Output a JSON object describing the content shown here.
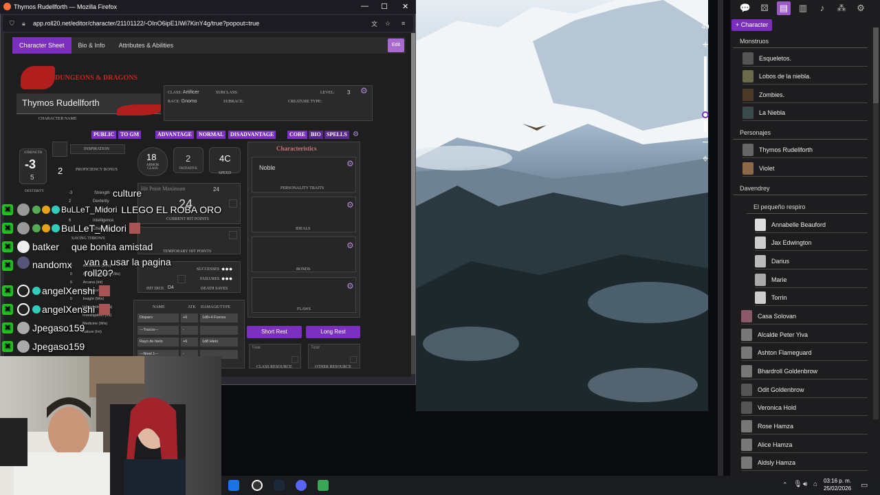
{
  "window": {
    "title": "Thymos Rudellforth — Mozilla Firefox",
    "url": "app.roll20.net/editor/character/21101122/-OInO6ipE1IWi7KinY4g/true?popout=true",
    "icons": [
      "firefox-icon",
      "minimize-icon",
      "maximize-icon",
      "close-icon",
      "lock-icon",
      "translate-icon",
      "star-icon",
      "menu-icon"
    ]
  },
  "sheet": {
    "tabs": [
      "Character Sheet",
      "Bio & Info",
      "Attributes & Abilities"
    ],
    "edit": "Edit",
    "logo": "DUNGEONS & DRAGONS",
    "character_name": "Thymos Rudellforth",
    "character_name_label": "CHARACTER NAME",
    "class_label": "CLASS:",
    "class_value": "Artificer",
    "subclass_label": "SUBCLASS:",
    "level_label": "LEVEL:",
    "level_value": "3",
    "race_label": "RACE:",
    "race_value": "Gnomo",
    "subrace_label": "SUBRACE:",
    "creature_type_label": "CREATURE TYPE:",
    "pills": [
      "PUBLIC",
      "TO GM",
      "ADVANTAGE",
      "NORMAL",
      "DISADVANTAGE",
      "CORE",
      "BIO",
      "SPELLS"
    ],
    "strength_label": "STRENGTH",
    "strength_mod": "-3",
    "strength_score": "5",
    "dexterity_label": "DEXTERITY",
    "inspiration_label": "INSPIRATION",
    "proficiency_value": "2",
    "proficiency_label": "PROFICIENCY BONUS",
    "armor_class": "18",
    "armor_class_label": "ARMOR CLASS",
    "initiative": "2",
    "initiative_label": "INITIATIVE",
    "speed": "4C",
    "speed_label": "SPEED",
    "hp_max_label": "Hit Point Maximum",
    "hp_max": "24",
    "hp_current": "24",
    "current_hp_label": "CURRENT HIT POINTS",
    "temp_hp_label": "TEMPORARY HIT POINTS",
    "successes_label": "SUCCESSES",
    "failures_label": "FAILURES",
    "hit_dice_label": "HIT DICE",
    "hit_dice": "D4",
    "death_saves_label": "DEATH SAVES",
    "saves": [
      {
        "v": "-3",
        "n": "Strength"
      },
      {
        "v": "2",
        "n": "Dexterity"
      },
      {
        "v": "6",
        "n": "Intelligence"
      },
      {
        "v": "2",
        "n": "Charisma"
      }
    ],
    "saving_throws_label": "SAVING THROWS",
    "skills": [
      {
        "v": "0",
        "n": "Acrobatics (Dex)"
      },
      {
        "v": "0",
        "n": "Animal Handling (Wis)"
      },
      {
        "v": "6",
        "n": "Arcana (Int)"
      },
      {
        "v": "",
        "n": "Deception (Cha)"
      },
      {
        "v": "0",
        "n": "Insight (Wis)"
      },
      {
        "v": "",
        "n": "Intimidation (Cha)"
      },
      {
        "v": "",
        "n": "Investigation (Int)"
      },
      {
        "v": "",
        "n": "Medicine (Wis)"
      },
      {
        "v": "",
        "n": "Nature (Int)"
      }
    ],
    "attack_headers": [
      "NAME",
      "ATK",
      "DAMAGE/TYPE"
    ],
    "attacks": [
      {
        "name": "Disparo",
        "atk": "+6",
        "dmg": "1d8+4 Fuerza"
      },
      {
        "name": "---Trucos---",
        "atk": "-",
        "dmg": ""
      },
      {
        "name": "Rayo de hielo",
        "atk": "+6",
        "dmg": "1d8 Hielo"
      },
      {
        "name": "---Nivel 1---",
        "atk": "-",
        "dmg": ""
      }
    ],
    "characteristics_title": "Characteristics",
    "personality": "Noble",
    "personality_label": "PERSONALITY TRAITS",
    "ideals_label": "IDEALS",
    "bonds_label": "BONDS",
    "flaws_label": "FLAWS",
    "short_rest": "Short Rest",
    "long_rest": "Long Rest",
    "total_label": "Total",
    "class_resource_label": "CLASS RESOURCE",
    "other_resource_label": "OTHER RESOURCE"
  },
  "chat": [
    {
      "user": "",
      "msg": "culture"
    },
    {
      "user": "BuLLeT_Midori",
      "msg": "LLEGO EL ROBA ORO"
    },
    {
      "user": "BuLLeT_Midori",
      "msg": ""
    },
    {
      "user": "batker",
      "msg": "que bonita amistad"
    },
    {
      "user": "nandomx",
      "msg": "van a usar la pagina roll20?"
    },
    {
      "user": "angelXenshi",
      "msg": ""
    },
    {
      "user": "angelXenshi",
      "msg": ""
    },
    {
      "user": "Jpegaso159",
      "msg": ""
    },
    {
      "user": "Jpegaso159",
      "msg": ""
    }
  ],
  "map_controls": {
    "zoom": "49",
    "icons": [
      "plus-icon",
      "minus-icon",
      "target-icon"
    ]
  },
  "journal": {
    "toolbar_icons": [
      "chat-icon",
      "dice-icon",
      "journal-icon",
      "compendium-icon",
      "jukebox-icon",
      "collection-icon",
      "settings-icon"
    ],
    "add_character": "+ Character",
    "folders": [
      {
        "name": "Monstruos",
        "items": [
          "Esqueletos.",
          "Lobos de la niebla.",
          "Zombies.",
          "La Niebla"
        ]
      },
      {
        "name": "Personajes",
        "items": [
          "Thymos Rudellforth",
          "Violet"
        ]
      },
      {
        "name": "Davendrey",
        "items": []
      },
      {
        "name": "El pequeño respiro",
        "items": [
          "Annabelle Beauford",
          "Jax Edwington",
          "Darius",
          "Marie",
          "Torrin"
        ]
      }
    ],
    "loose_items": [
      "Casa Solovan",
      "Alcalde Peter Yiva",
      "Ashton Flameguard",
      "Bhardroll Goldenbrow",
      "Odit Goldenbrow",
      "Veronica Hold",
      "Rose Hamza",
      "Alice Hamza",
      "Aldsly Hamza"
    ]
  },
  "taskbar": {
    "time": "03:16 p. m.",
    "date": "25/02/2026",
    "icons": [
      "edge-icon",
      "obs-icon",
      "steam-icon",
      "discord-icon",
      "game-icon",
      "chevron-up-icon",
      "mic-icon",
      "volume-icon",
      "network-icon",
      "notification-icon"
    ]
  }
}
